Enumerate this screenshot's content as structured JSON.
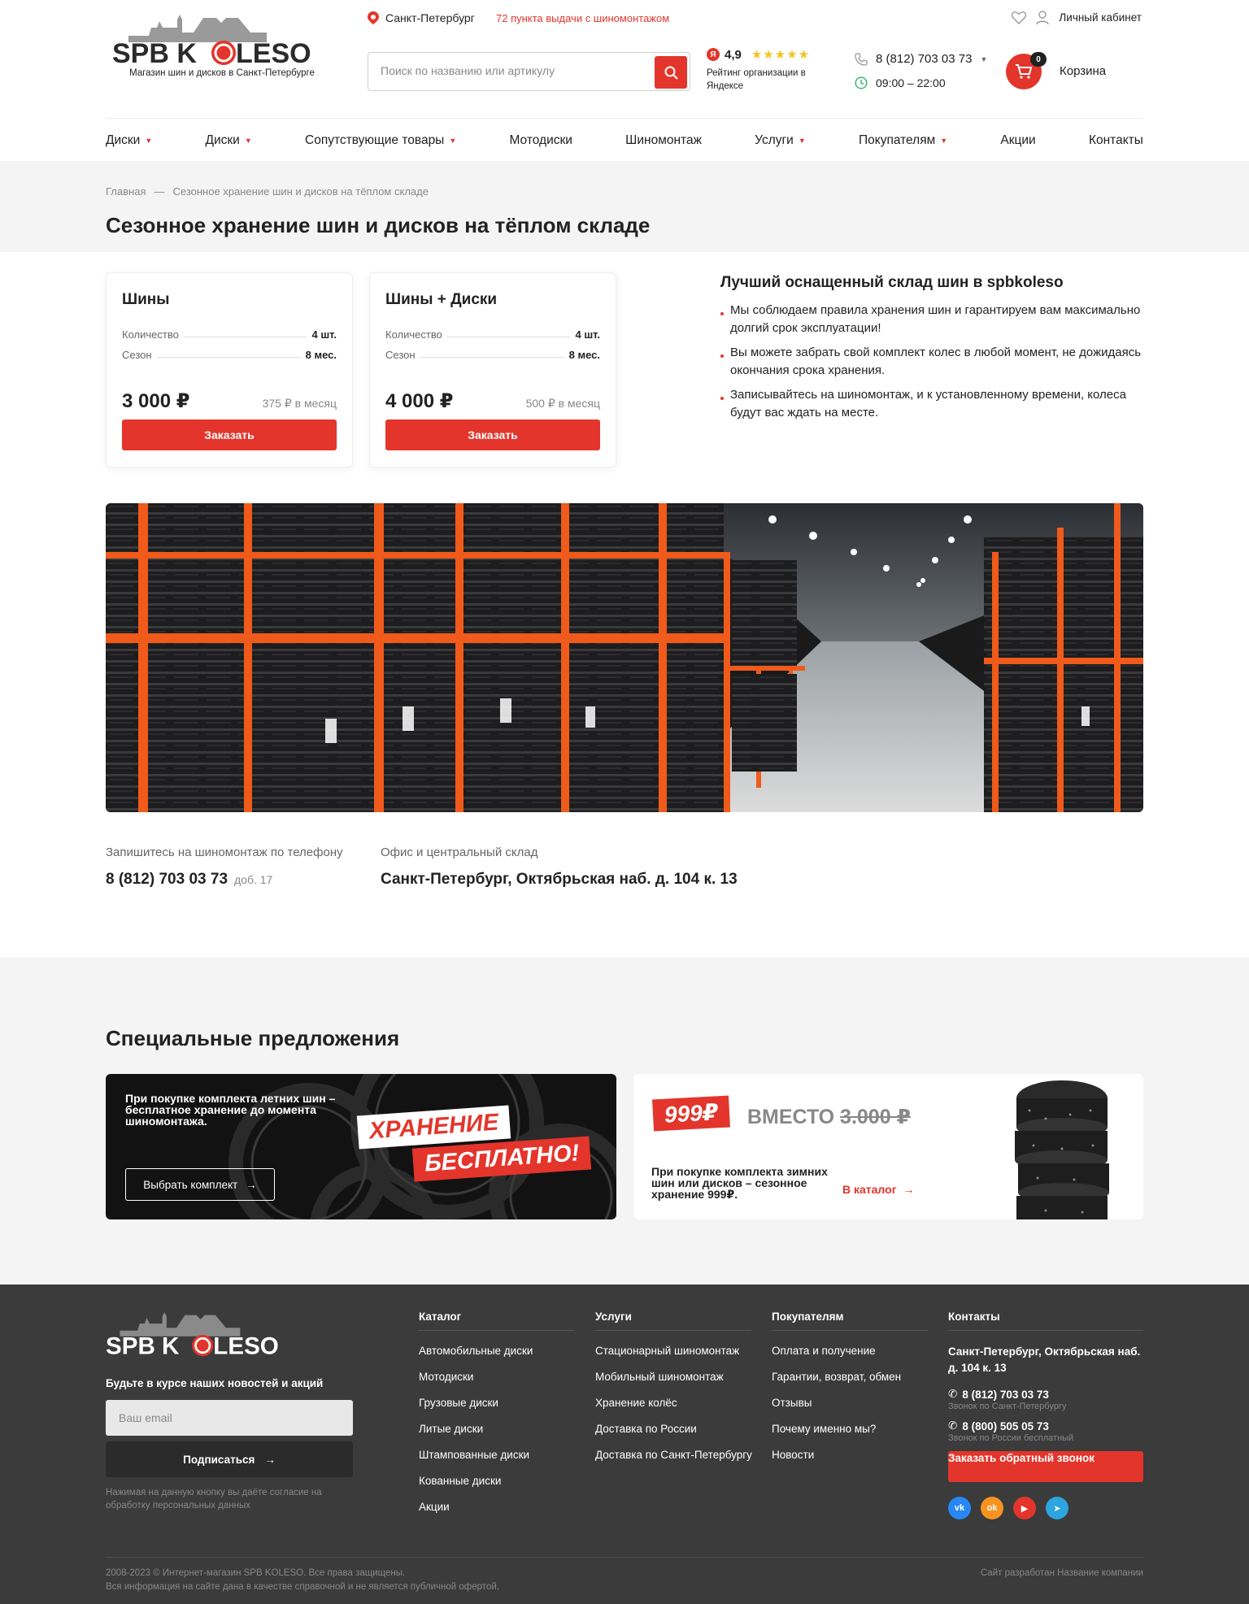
{
  "brand": {
    "name": "SPB KOLESO",
    "tagline": "Магазин шин и дисков в Санкт-Петербурге"
  },
  "header": {
    "city": "Санкт-Петербург",
    "pickup_points": "72 пункта выдачи с шиномонтажом",
    "search_placeholder": "Поиск по названию или артикулу",
    "rating_value": "4,9",
    "rating_label": "Рейтинг организации в Яндексе",
    "rating_stars": 5,
    "phone": "8 (812) 703 03 73",
    "hours": "09:00 – 22:00",
    "account": "Личный кабинет",
    "cart_label": "Корзина",
    "cart_count": "0"
  },
  "nav": [
    {
      "label": "Диски",
      "dropdown": true
    },
    {
      "label": "Диски",
      "dropdown": true
    },
    {
      "label": "Сопутствующие товары",
      "dropdown": true
    },
    {
      "label": "Мотодиски",
      "dropdown": false
    },
    {
      "label": "Шиномонтаж",
      "dropdown": false
    },
    {
      "label": "Услуги",
      "dropdown": true
    },
    {
      "label": "Покупателям",
      "dropdown": true
    },
    {
      "label": "Акции",
      "dropdown": false
    },
    {
      "label": "Контакты",
      "dropdown": false
    }
  ],
  "breadcrumbs": [
    "Главная",
    "Сезонное хранение шин и дисков на тёплом складе"
  ],
  "breadcrumb_sep": "—",
  "page_title": "Сезонное хранение шин и дисков на тёплом складе",
  "tariffs": [
    {
      "title": "Шины",
      "qty_label": "Количество",
      "qty": "4 шт.",
      "season_label": "Сезон",
      "season": "8 мес.",
      "price": "3 000 ₽",
      "per_month": "375 ₽ в месяц",
      "button": "Заказать"
    },
    {
      "title": "Шины + Диски",
      "qty_label": "Количество",
      "qty": "4 шт.",
      "season_label": "Сезон",
      "season": "8 мес.",
      "price": "4 000 ₽",
      "per_month": "500 ₽ в месяц",
      "button": "Заказать"
    }
  ],
  "advantages": {
    "title": "Лучший оснащенный склад шин в spbkoleso",
    "items": [
      "Мы соблюдаем правила хранения шин и гарантируем вам максимально долгий срок эксплуатации!",
      "Вы можете забрать свой комплект колес в любой момент, не дожидаясь окончания срока хранения.",
      "Записывайтесь на шиномонтаж, и к установленному времени, колеса будут вас ждать на месте."
    ]
  },
  "contact_info": {
    "phone_label": "Запишитесь на шиномонтаж по телефону",
    "phone": "8 (812) 703 03 73",
    "ext": "доб. 17",
    "office_label": "Офис и центральный склад",
    "office": "Санкт-Петербург, Октябрьская наб. д. 104 к. 13"
  },
  "offers": {
    "title": "Специальные предложения",
    "promo1": {
      "text": "При покупке комплекта летних шин – бесплатное хранение до момента шиномонтажа.",
      "button": "Выбрать комплект",
      "sticker1": "ХРАНЕНИЕ",
      "sticker2": "БЕСПЛАТНО!"
    },
    "promo2": {
      "badge": "999₽",
      "instead": "ВМЕСТО",
      "old_price": "3.000 ₽",
      "text": "При покупке комплекта зимних шин или дисков – сезонное хранение 999₽.",
      "link": "В каталог"
    }
  },
  "footer": {
    "newsletter_title": "Будьте в курсе наших новостей и акций",
    "email_placeholder": "Ваш email",
    "subscribe": "Подписаться",
    "consent": "Нажимая на данную кнопку вы даёте согласие на обработку персональных данных",
    "catalog": {
      "title": "Каталог",
      "items": [
        "Автомобильные диски",
        "Мотодиски",
        "Грузовые диски",
        "Литые диски",
        "Штампованные диски",
        "Кованные диски",
        "Акции"
      ]
    },
    "services": {
      "title": "Услуги",
      "items": [
        "Стационарный шиномонтаж",
        "Мобильный шиномонтаж",
        "Хранение колёс",
        "Доставка по России",
        "Доставка по Санкт-Петербургу"
      ]
    },
    "buyers": {
      "title": "Покупателям",
      "items": [
        "Оплата и получение",
        "Гарантии, возврат, обмен",
        "Отзывы",
        "Почему именно мы?",
        "Новости"
      ]
    },
    "contacts": {
      "title": "Контакты",
      "address": "Санкт-Петербург, Октябрьская наб. д. 104 к. 13",
      "phone1": "8 (812) 703 03 73",
      "phone1_note": "Звонок по Санкт-Петербургу",
      "phone2": "8 (800) 505 05 73",
      "phone2_note": "Звонок по России бесплатный",
      "callback": "Заказать обратный звонок"
    },
    "socials": [
      {
        "name": "vk-icon",
        "color": "#2787f5"
      },
      {
        "name": "odnoklassniki-icon",
        "color": "#f7931e"
      },
      {
        "name": "youtube-icon",
        "color": "#e3352b"
      },
      {
        "name": "telegram-icon",
        "color": "#2ca5e0"
      }
    ],
    "copyright": "2008-2023 © Интернет-магазин SPB KOLESO. Все права защищены.",
    "disclaimer": "Вся информация на сайте дана в качестве справочной и не является публичной офертой.",
    "developer": "Сайт разработан Название компании"
  },
  "colors": {
    "accent": "#e3352b",
    "footer_bg": "#3b3b3b",
    "band_bg": "#f4f4f4",
    "star": "#f7c21a"
  }
}
